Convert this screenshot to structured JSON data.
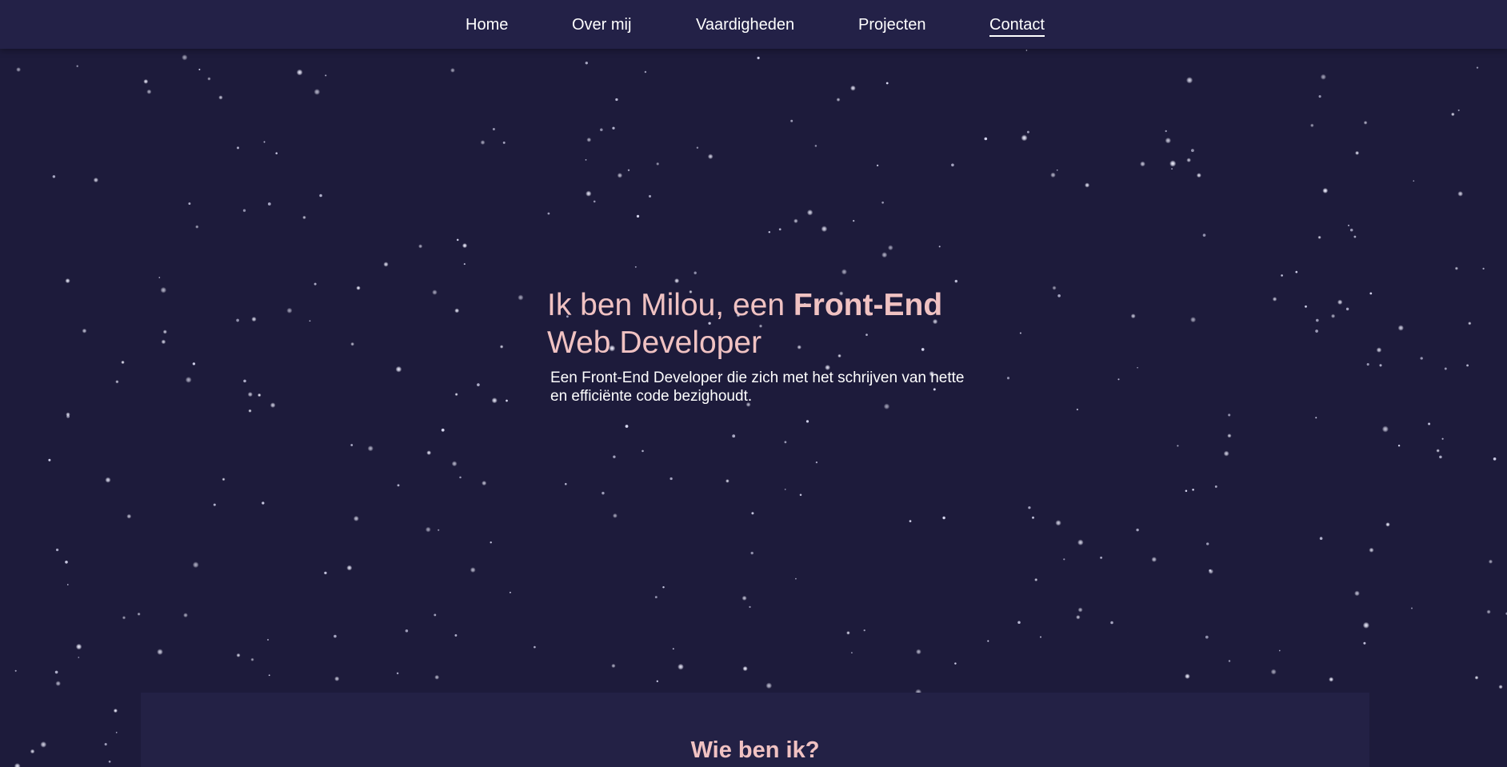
{
  "nav": {
    "items": [
      {
        "label": "Home"
      },
      {
        "label": "Over mij"
      },
      {
        "label": "Vaardigheden"
      },
      {
        "label": "Projecten"
      },
      {
        "label": "Contact"
      }
    ]
  },
  "hero": {
    "title_prefix": "Ik ben Milou, een ",
    "title_highlight": "Front-End",
    "title_suffix": "Web Developer",
    "subtitle": "Een Front-End Developer die zich met het schrijven van nette en efficiënte code bezighoudt."
  },
  "about": {
    "title": "Wie ben ik?"
  },
  "colors": {
    "background": "#1d1b3b",
    "navbar": "#232147",
    "accent": "#f0c2c2",
    "text": "#ffffff",
    "star": "#ffffff"
  }
}
